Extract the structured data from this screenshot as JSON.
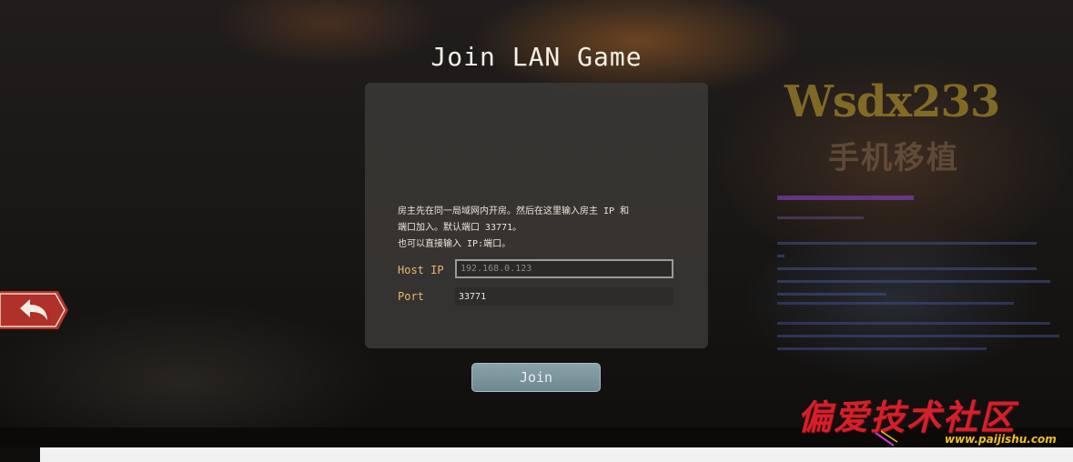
{
  "screen": {
    "title": "Join LAN Game"
  },
  "dialog": {
    "description_lines": [
      "房主先在同一局域网内开房。然后在这里输入房主 IP 和",
      "端口加入。默认端口 33771。",
      "也可以直接输入 IP:端口。"
    ],
    "host_ip": {
      "label": "Host IP",
      "value": "",
      "placeholder": "192.168.0.123"
    },
    "port": {
      "label": "Port",
      "value": "33771"
    },
    "join_label": "Join"
  },
  "back_button": {
    "icon": "back-arrow-icon"
  },
  "background_logo": {
    "main": "Wsdx233",
    "sub": "手机移植"
  },
  "watermark": {
    "title": "偏爱技术社区",
    "url": "www.paijishu.com"
  },
  "colors": {
    "title_text": "#f4f0e6",
    "label_accent": "#e6b86c",
    "join_button": "#7d959d",
    "back_button_red": "#b0302a",
    "watermark_red": "#d4202a",
    "watermark_yellow": "#f0c020"
  }
}
